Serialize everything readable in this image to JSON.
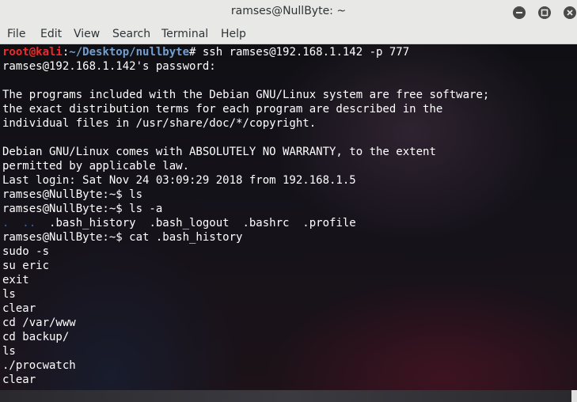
{
  "window": {
    "title": "ramses@NullByte: ~"
  },
  "menu": {
    "file": "File",
    "edit": "Edit",
    "view": "View",
    "search": "Search",
    "terminal": "Terminal",
    "help": "Help"
  },
  "prompt": {
    "root_user": "root@kali",
    "root_sep": ":",
    "root_path": "~/Desktop/nullbyte",
    "root_symbol": "# ",
    "ssh_command": "ssh ramses@192.168.1.142 -p 777"
  },
  "lines": {
    "password_prompt": "ramses@192.168.1.142's password:",
    "motd_1": "The programs included with the Debian GNU/Linux system are free software;",
    "motd_2": "the exact distribution terms for each program are described in the",
    "motd_3": "individual files in /usr/share/doc/*/copyright.",
    "motd_4": "Debian GNU/Linux comes with ABSOLUTELY NO WARRANTY, to the extent",
    "motd_5": "permitted by applicable law.",
    "last_login": "Last login: Sat Nov 24 03:09:29 2018 from 192.168.1.5",
    "cmd_ls": "ramses@NullByte:~$ ls",
    "cmd_ls_a": "ramses@NullByte:~$ ls -a",
    "ls_dot": ".",
    "ls_dotdot": "..",
    "ls_files": ".bash_history  .bash_logout  .bashrc  .profile",
    "cmd_cat": "ramses@NullByte:~$ cat .bash_history"
  },
  "history": [
    "sudo -s",
    "su eric",
    "exit",
    "ls",
    "clear",
    "cd /var/www",
    "cd backup/",
    "ls",
    "./procwatch",
    "clear"
  ],
  "colors": {
    "root_user": "#ef2929",
    "path": "#729fcf",
    "text": "#ffffff",
    "titlebar": "#e8e8e7"
  },
  "icons": {
    "minimize": "minimize-icon",
    "maximize": "maximize-icon",
    "close": "close-icon"
  }
}
